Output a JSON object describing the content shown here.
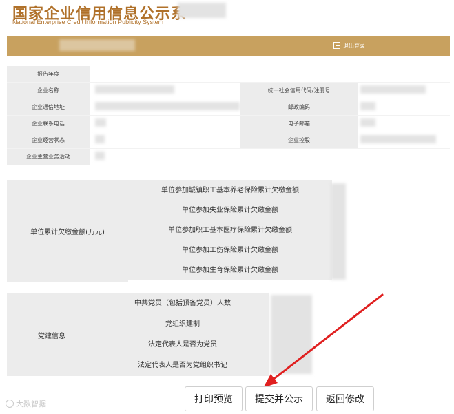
{
  "header": {
    "title_cn": "国家企业信用信息公示系",
    "title_en": "National Enterprise Credit Information Publicity System"
  },
  "topbar": {
    "left_text": "",
    "logout_label": "退出登录"
  },
  "basic_info": {
    "rows": [
      {
        "label": "报告年度"
      },
      {
        "label": "企业名称",
        "right_label": "统一社会信用代码/注册号"
      },
      {
        "label": "企业通信地址",
        "right_label": "邮政编码"
      },
      {
        "label": "企业联系电话",
        "right_label": "电子邮箱"
      },
      {
        "label": "企业经营状态",
        "right_label": "企业控股"
      },
      {
        "label": "企业主营业务活动"
      }
    ]
  },
  "arrears": {
    "title": "单位累计欠缴金额(万元)",
    "items": [
      "单位参加城镇职工基本养老保险累计欠缴金额",
      "单位参加失业保险累计欠缴金额",
      "单位参加职工基本医疗保险累计欠缴金额",
      "单位参加工伤保险累计欠缴金额",
      "单位参加生育保险累计欠缴金额"
    ]
  },
  "party": {
    "title": "党建信息",
    "items": [
      "中共党员（包括预备党员）人数",
      "党组织建制",
      "法定代表人是否为党员",
      "法定代表人是否为党组织书记"
    ]
  },
  "buttons": {
    "print_preview": "打印预览",
    "submit_publish": "提交并公示",
    "return_modify": "返回修改"
  },
  "watermark": "大数智据",
  "colors": {
    "brand_gold": "#c8a15f",
    "title_gold": "#b0712a",
    "arrow_red": "#e02020"
  }
}
